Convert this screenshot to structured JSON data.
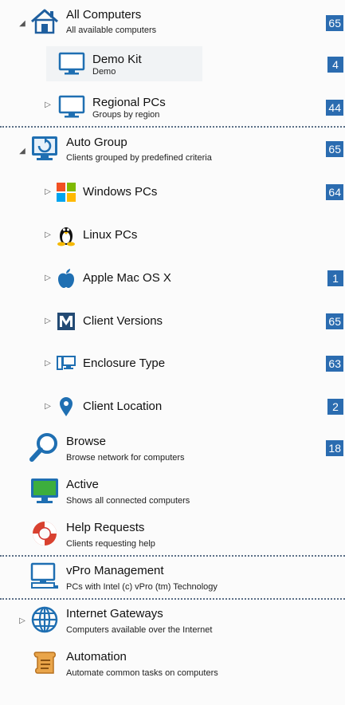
{
  "tree": {
    "all_computers": {
      "label": "All Computers",
      "sublabel": "All available computers",
      "count": "65",
      "icon": "home-icon",
      "expanded": true
    },
    "demo_kit": {
      "label": "Demo  Kit",
      "sublabel": "Demo",
      "count": "4",
      "icon": "monitor-icon"
    },
    "regional_pcs": {
      "label": "Regional PCs",
      "sublabel": "Groups by region",
      "count": "44",
      "icon": "monitor-icon"
    },
    "auto_group": {
      "label": "Auto Group",
      "sublabel": "Clients grouped by predefined criteria",
      "count": "65",
      "icon": "refresh-monitor-icon",
      "expanded": true
    },
    "windows_pcs": {
      "label": "Windows PCs",
      "count": "64",
      "icon": "windows-logo-icon"
    },
    "linux_pcs": {
      "label": "Linux PCs",
      "count": "",
      "icon": "linux-penguin-icon"
    },
    "apple_mac": {
      "label": "Apple Mac OS X",
      "count": "1",
      "icon": "apple-logo-icon"
    },
    "client_versions": {
      "label": "Client Versions",
      "count": "65",
      "icon": "m-logo-icon"
    },
    "enclosure_type": {
      "label": "Enclosure Type",
      "count": "63",
      "icon": "enclosure-icon"
    },
    "client_location": {
      "label": "Client Location",
      "count": "2",
      "icon": "map-pin-icon"
    },
    "browse": {
      "label": "Browse",
      "sublabel": "Browse network for computers",
      "count": "18",
      "icon": "magnifier-icon"
    },
    "active": {
      "label": "Active",
      "sublabel": "Shows all connected computers",
      "icon": "active-monitor-icon"
    },
    "help_requests": {
      "label": "Help Requests",
      "sublabel": "Clients requesting help",
      "icon": "lifebuoy-icon"
    },
    "vpro": {
      "label": "vPro Management",
      "sublabel": "PCs with Intel (c) vPro (tm) Technology",
      "icon": "vpro-computer-icon"
    },
    "internet_gateways": {
      "label": "Internet Gateways",
      "sublabel": "Computers available over the Internet",
      "icon": "globe-icon"
    },
    "automation": {
      "label": "Automation",
      "sublabel": "Automate common tasks on computers",
      "icon": "scroll-icon"
    }
  },
  "colors": {
    "badge": "#2b6cb0",
    "icon_blue": "#1f6fb2",
    "separator": "#5b6f87"
  }
}
